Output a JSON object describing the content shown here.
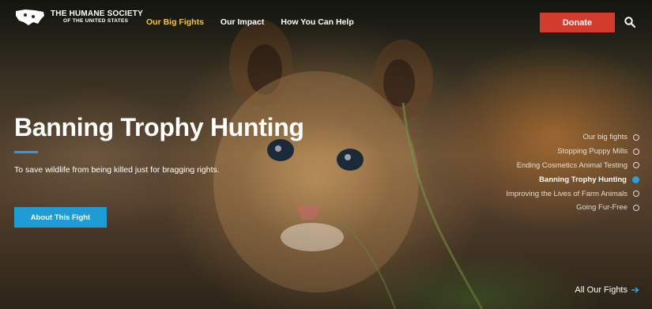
{
  "brand": {
    "line1": "THE HUMANE SOCIETY",
    "line2": "OF THE UNITED STATES"
  },
  "nav": [
    {
      "label": "Our Big Fights",
      "active": true
    },
    {
      "label": "Our Impact",
      "active": false
    },
    {
      "label": "How You Can Help",
      "active": false
    }
  ],
  "header": {
    "donate_label": "Donate",
    "search_icon": "search-icon"
  },
  "hero": {
    "title": "Banning Trophy Hunting",
    "subtitle": "To save wildlife from being killed just for bragging rights.",
    "cta_label": "About This Fight"
  },
  "sidenav": {
    "items": [
      {
        "label": "Our big fights",
        "active": false
      },
      {
        "label": "Stopping Puppy Mills",
        "active": false
      },
      {
        "label": "Ending Cosmetics Animal Testing",
        "active": false
      },
      {
        "label": "Banning Trophy Hunting",
        "active": true
      },
      {
        "label": "Improving the Lives of Farm Animals",
        "active": false
      },
      {
        "label": "Going Fur-Free",
        "active": false
      }
    ]
  },
  "footer_link": {
    "label": "All Our Fights",
    "icon": "arrow-right-icon"
  },
  "colors": {
    "accent_blue": "#29a0dc",
    "donate_red": "#d33b2c",
    "nav_active": "#f5c431"
  }
}
